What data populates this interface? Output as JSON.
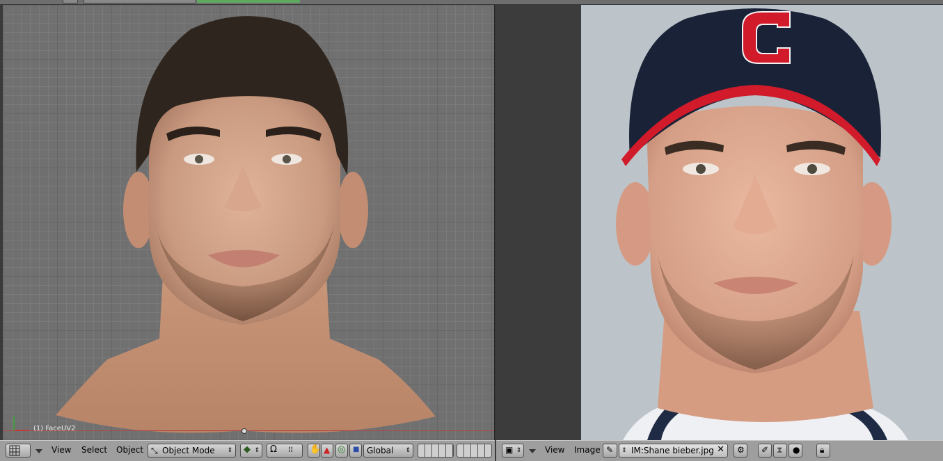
{
  "viewport": {
    "object_label": "(1) FaceUV2"
  },
  "left_header": {
    "menus": [
      "View",
      "Select",
      "Object"
    ],
    "mode": "Object Mode",
    "orientation": "Global",
    "icons": [
      "grid-icon",
      "shading-icon",
      "snap-icon",
      "hand-icon",
      "triangle-icon",
      "circle-icon",
      "square-icon"
    ]
  },
  "right_header": {
    "menus": [
      "View",
      "Image"
    ],
    "image_name": "IM:Shane bieber.jpg",
    "icons": [
      "image-icon",
      "pin-icon",
      "close-icon",
      "lock-icon"
    ]
  },
  "photo": {
    "cap_logo_letter": "C",
    "cap_color": "#1a2238",
    "cap_stripe_color": "#d11a2a",
    "background_color": "#bcc4ca"
  }
}
